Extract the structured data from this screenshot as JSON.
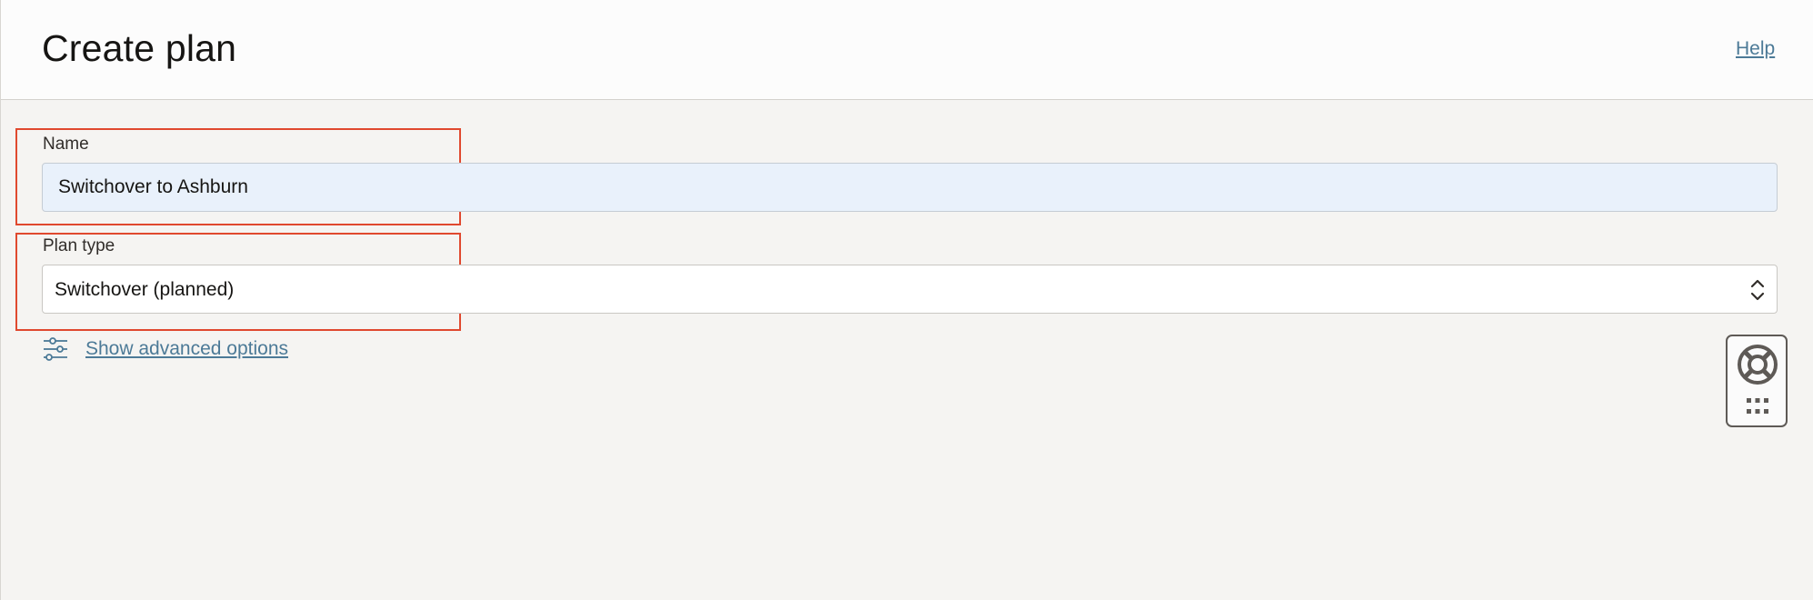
{
  "header": {
    "title": "Create plan",
    "help_label": "Help"
  },
  "form": {
    "name_label": "Name",
    "name_value": "Switchover to Ashburn",
    "plan_type_label": "Plan type",
    "plan_type_value": "Switchover (planned)",
    "advanced_label": "Show advanced options"
  },
  "icons": {
    "advanced": "sliders-icon",
    "select": "chevron-updown-icon",
    "help_widget": "lifebuoy-icon",
    "help_widget_menu": "grid-icon"
  },
  "colors": {
    "link": "#4c7a97",
    "highlight": "#e0492f",
    "name_input_bg": "#e9f1fb",
    "page_bg": "#f5f4f2"
  }
}
